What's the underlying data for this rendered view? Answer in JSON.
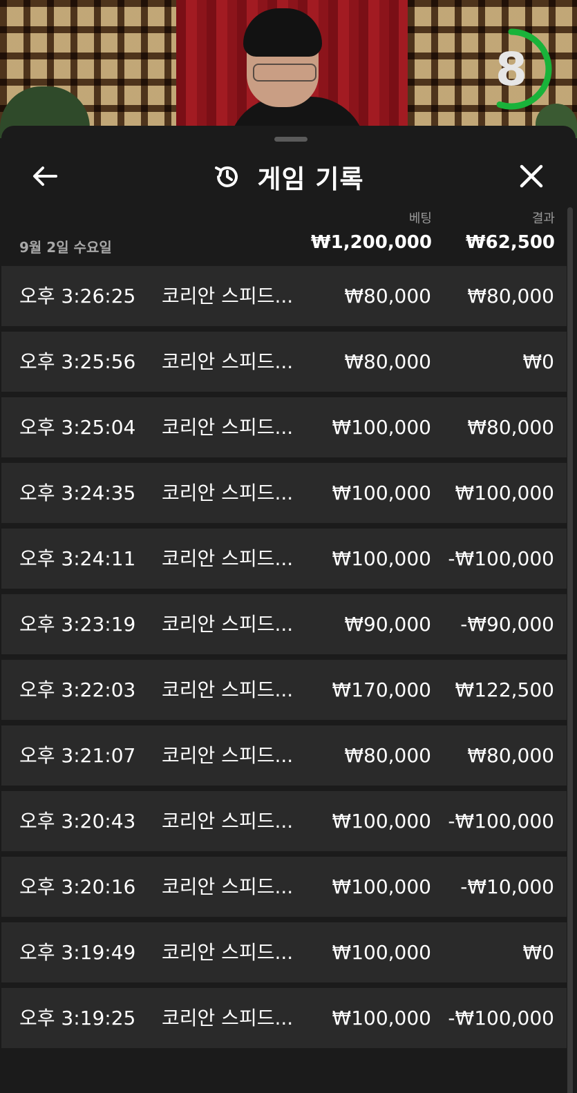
{
  "timer": {
    "value": "8",
    "fraction": 0.55,
    "color": "#19b33a"
  },
  "header": {
    "title": "게임 기록",
    "back_icon": "arrow-left-icon",
    "history_icon": "history-icon",
    "close_icon": "close-icon"
  },
  "summary": {
    "bet_label": "베팅",
    "result_label": "결과",
    "date": "9월 2일 수요일",
    "total_bet": "₩1,200,000",
    "total_result": "₩62,500"
  },
  "rows": [
    {
      "time": "오후 3:26:25",
      "game": "코리안 스피드...",
      "bet": "₩80,000",
      "result": "₩80,000"
    },
    {
      "time": "오후 3:25:56",
      "game": "코리안 스피드...",
      "bet": "₩80,000",
      "result": "₩0"
    },
    {
      "time": "오후 3:25:04",
      "game": "코리안 스피드...",
      "bet": "₩100,000",
      "result": "₩80,000"
    },
    {
      "time": "오후 3:24:35",
      "game": "코리안 스피드...",
      "bet": "₩100,000",
      "result": "₩100,000"
    },
    {
      "time": "오후 3:24:11",
      "game": "코리안 스피드...",
      "bet": "₩100,000",
      "result": "-₩100,000"
    },
    {
      "time": "오후 3:23:19",
      "game": "코리안 스피드...",
      "bet": "₩90,000",
      "result": "-₩90,000"
    },
    {
      "time": "오후 3:22:03",
      "game": "코리안 스피드...",
      "bet": "₩170,000",
      "result": "₩122,500"
    },
    {
      "time": "오후 3:21:07",
      "game": "코리안 스피드...",
      "bet": "₩80,000",
      "result": "₩80,000"
    },
    {
      "time": "오후 3:20:43",
      "game": "코리안 스피드...",
      "bet": "₩100,000",
      "result": "-₩100,000"
    },
    {
      "time": "오후 3:20:16",
      "game": "코리안 스피드...",
      "bet": "₩100,000",
      "result": "-₩10,000"
    },
    {
      "time": "오후 3:19:49",
      "game": "코리안 스피드...",
      "bet": "₩100,000",
      "result": "₩0"
    },
    {
      "time": "오후 3:19:25",
      "game": "코리안 스피드...",
      "bet": "₩100,000",
      "result": "-₩100,000"
    }
  ]
}
